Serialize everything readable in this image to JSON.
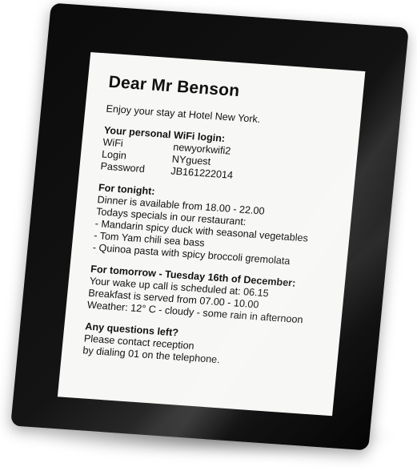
{
  "letter": {
    "greeting": "Dear Mr Benson",
    "welcome": "Enjoy your stay at Hotel New York.",
    "wifi": {
      "heading": "Your personal WiFi login:",
      "rows": [
        {
          "label": "WiFi",
          "value": "newyorkwifi2"
        },
        {
          "label": "Login",
          "value": "NYguest"
        },
        {
          "label": "Password",
          "value": "JB161222014"
        }
      ]
    },
    "tonight": {
      "heading": "For tonight:",
      "lines": [
        "Dinner is available from 18.00 - 22.00",
        "Todays specials in our restaurant:",
        "- Mandarin spicy duck with seasonal vegetables",
        "- Tom Yam chili sea bass",
        "- Quinoa pasta with spicy broccoli gremolata"
      ]
    },
    "tomorrow": {
      "heading": "For tomorrow - Tuesday 16th of December:",
      "lines": [
        "Your wake up call is scheduled at: 06.15",
        "Breakfast is served from 07.00 - 10.00",
        "Weather: 12° C - cloudy - some rain in afternoon"
      ]
    },
    "questions": {
      "heading": "Any questions left?",
      "lines": [
        "Please contact reception",
        "by dialing 01 on the telephone."
      ]
    }
  },
  "colors": {
    "frame": "#0b0b0b",
    "screen": "#f7f7f5",
    "text": "#111111"
  }
}
